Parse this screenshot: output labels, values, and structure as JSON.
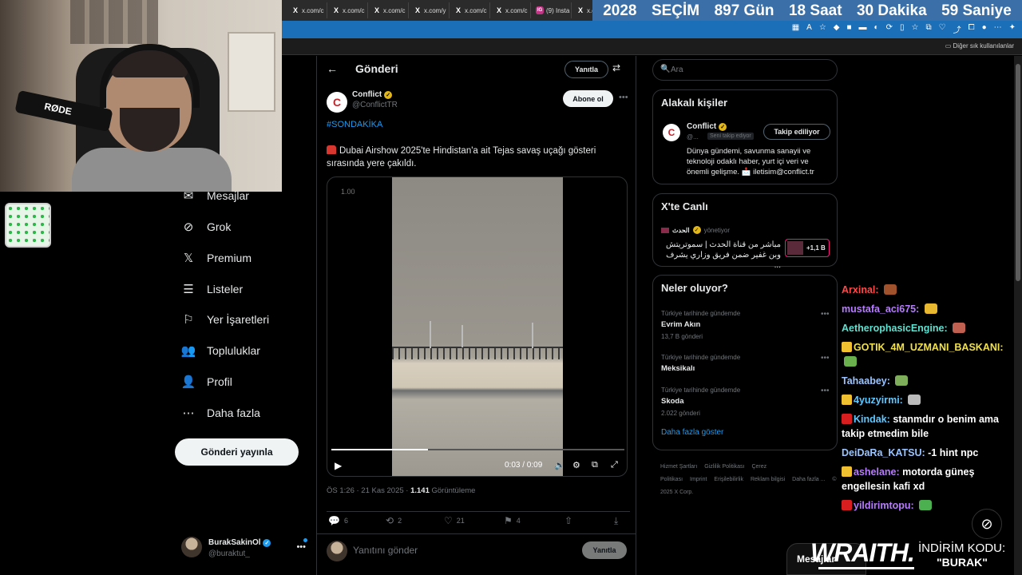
{
  "browser": {
    "tabs": [
      {
        "icon": "X",
        "label": "x.com/c"
      },
      {
        "icon": "X",
        "label": "x.com/c"
      },
      {
        "icon": "X",
        "label": "x.com/c"
      },
      {
        "icon": "X",
        "label": "x.com/y"
      },
      {
        "icon": "X",
        "label": "x.com/c"
      },
      {
        "icon": "X",
        "label": "x.com/c"
      },
      {
        "icon": "IG",
        "label": "(9) Insta"
      },
      {
        "icon": "X",
        "label": "x.com/e"
      }
    ],
    "other_bookmarks": "Diğer sık kullanılanlar"
  },
  "countdown": {
    "year": "2028",
    "label": "SEÇİM",
    "days": "897 Gün",
    "hours": "18 Saat",
    "minutes": "30 Dakika",
    "seconds": "59 Saniye"
  },
  "webcam": {
    "mic_brand": "RØDE"
  },
  "nav": {
    "items": [
      {
        "label": "Mesajlar",
        "icon": "mail-icon"
      },
      {
        "label": "Grok",
        "icon": "grok-icon"
      },
      {
        "label": "Premium",
        "icon": "x-logo-icon"
      },
      {
        "label": "Listeler",
        "icon": "list-icon"
      },
      {
        "label": "Yer İşaretleri",
        "icon": "bookmark-icon"
      },
      {
        "label": "Topluluklar",
        "icon": "communities-icon"
      },
      {
        "label": "Profil",
        "icon": "profile-icon"
      },
      {
        "label": "Daha fazla",
        "icon": "more-icon"
      }
    ],
    "post_button": "Gönderi yayınla",
    "account": {
      "name": "BurakSakinOl",
      "handle": "@buraktut_"
    }
  },
  "post": {
    "header_title": "Gönderi",
    "reply_button": "Yanıtla",
    "author_name": "Conflict",
    "author_handle": "@ConflictTR",
    "subscribe_button": "Abone ol",
    "hashtag": "#SONDAKİKA",
    "text": "Dubai Airshow 2025'te Hindistan'a ait Tejas savaş uçağı gösteri sırasında yere çakıldı.",
    "video": {
      "speed": "1.00",
      "time": "0:03 / 0:09",
      "progress": 0.33
    },
    "time_date": "ÖS 1:26 · 21 Kas 2025 · ",
    "views_count": "1.141",
    "views_label": " Görüntüleme",
    "stats": {
      "replies": "6",
      "reposts": "2",
      "likes": "21",
      "bookmarks": "4"
    },
    "reply_placeholder": "Yanıtını gönder",
    "reply_submit": "Yanıtla"
  },
  "sidebar": {
    "search_placeholder": "Ara",
    "relevant": {
      "title": "Alakalı kişiler",
      "name": "Conflict",
      "handle": "@...",
      "follows_you": "Seni takip ediyor",
      "follow_button": "Takip ediliyor",
      "bio": "Dünya gündemi, savunma sanayii ve teknoloji odaklı haber, yurt içi veri ve önemli gelişme. 📩 iletisim@conflict.tr"
    },
    "live": {
      "title": "X'te Canlı",
      "source": "الحدث",
      "managing": "yönetiyor",
      "stream_title": "مباشر من قناة الحدث | سموتريتش وبن غفير ضمن فريق وزاري يشرف ...",
      "viewers": "+1,1 B"
    },
    "trends": {
      "title": "Neler oluyor?",
      "items": [
        {
          "context": "Türkiye tarihinde gündemde",
          "name": "Evrim Akın",
          "count": "13,7 B gönderi"
        },
        {
          "context": "Türkiye tarihinde gündemde",
          "name": "Meksikalı",
          "count": ""
        },
        {
          "context": "Türkiye tarihinde gündemde",
          "name": "Skoda",
          "count": "2.022 gönderi"
        }
      ],
      "show_more": "Daha fazla göster"
    },
    "footer": [
      "Hizmet Şartları",
      "Gizlilik Politikası",
      "Çerez Politikası",
      "Imprint",
      "Erişilebilirlik",
      "Reklam bilgisi",
      "Daha fazla ...",
      "© 2025 X Corp."
    ]
  },
  "chat": [
    {
      "user": "Arxinal:",
      "text": "",
      "color": "#ff4a4a"
    },
    {
      "user": "mustafa_aci675:",
      "text": "",
      "color": "#b77cff"
    },
    {
      "user": "AetherophasicEngine:",
      "text": "",
      "color": "#5fe0d0"
    },
    {
      "user": "GOTIK_4M_UZMANI_BASKANI:",
      "text": "",
      "color": "#f0e04a"
    },
    {
      "user": "Tahaabey:",
      "text": "",
      "color": "#9ac4ff"
    },
    {
      "user": "4yuzyirmi:",
      "text": "",
      "color": "#5fc8ff"
    },
    {
      "user": "Kindak:",
      "text": "stanmdır o benim ama takip etmedim bile",
      "color": "#5fc8ff"
    },
    {
      "user": "DeiDaRa_KATSU:",
      "text": "-1 hint npc",
      "color": "#9ac4ff"
    },
    {
      "user": "ashelane:",
      "text": "motorda güneş engellesin kafi xd",
      "color": "#b77cff"
    },
    {
      "user": "yildirimtopu:",
      "text": "",
      "color": "#b77cff"
    }
  ],
  "overlay": {
    "sponsor_brand": "WRAITH.",
    "code_label": "İNDİRİM KODU:",
    "code": "\"BURAK\"",
    "messages_tab": "Mesajlar"
  }
}
